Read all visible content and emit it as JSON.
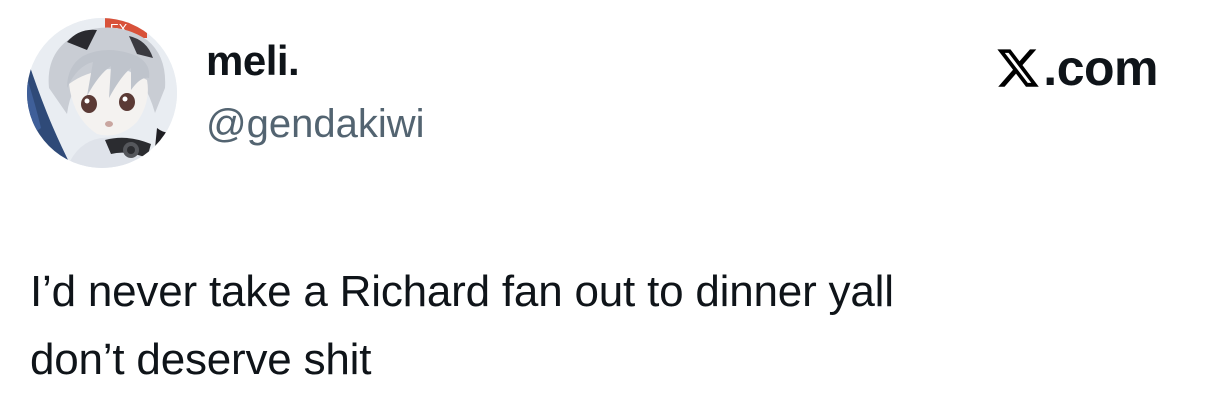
{
  "author": {
    "display_name": "meli.",
    "handle": "@gendakiwi",
    "avatar_badge_text": "EX"
  },
  "brand": {
    "text": ".com",
    "icon": "x-logo-icon"
  },
  "tweet": {
    "line1": "I’d never take a Richard fan out to dinner yall",
    "line2": "don’t deserve shit"
  }
}
